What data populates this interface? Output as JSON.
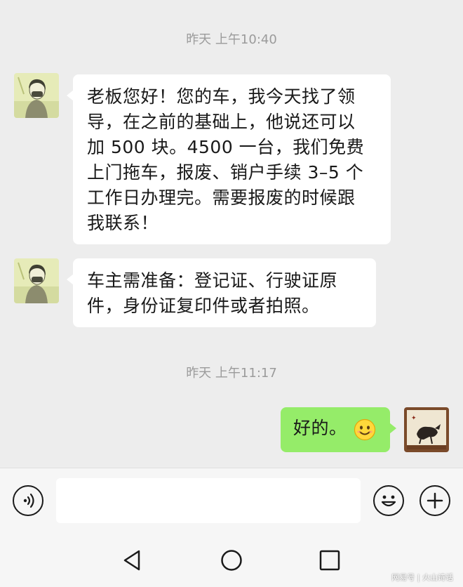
{
  "chat": {
    "timestamp_1": "昨天 上午10:40",
    "timestamp_2": "昨天 上午11:17",
    "messages": [
      {
        "sender": "other",
        "text": "老板您好！您的车，我今天找了领\n导，在之前的基础上，他说还可以\n加 500 块。4500 一台，我们免费\n上门拖车，报废、销户手续 3–5 个\n工作日办理完。需要报废的时候跟\n我联系！"
      },
      {
        "sender": "other",
        "text": "车主需准备：登记证、行驶证原\n件，身份证复印件或者拍照。"
      },
      {
        "sender": "me",
        "text": "好的。"
      }
    ]
  },
  "input_bar": {
    "voice_icon": "voice-icon",
    "emoji_icon": "emoji-icon",
    "plus_icon": "plus-icon"
  },
  "nav": {
    "back_icon": "back-triangle-icon",
    "home_icon": "home-circle-icon",
    "recents_icon": "recents-square-icon"
  },
  "watermark": "网易号 | 火山诗话",
  "colors": {
    "background": "#ededed",
    "incoming_bubble": "#ffffff",
    "outgoing_bubble": "#95ec69"
  }
}
